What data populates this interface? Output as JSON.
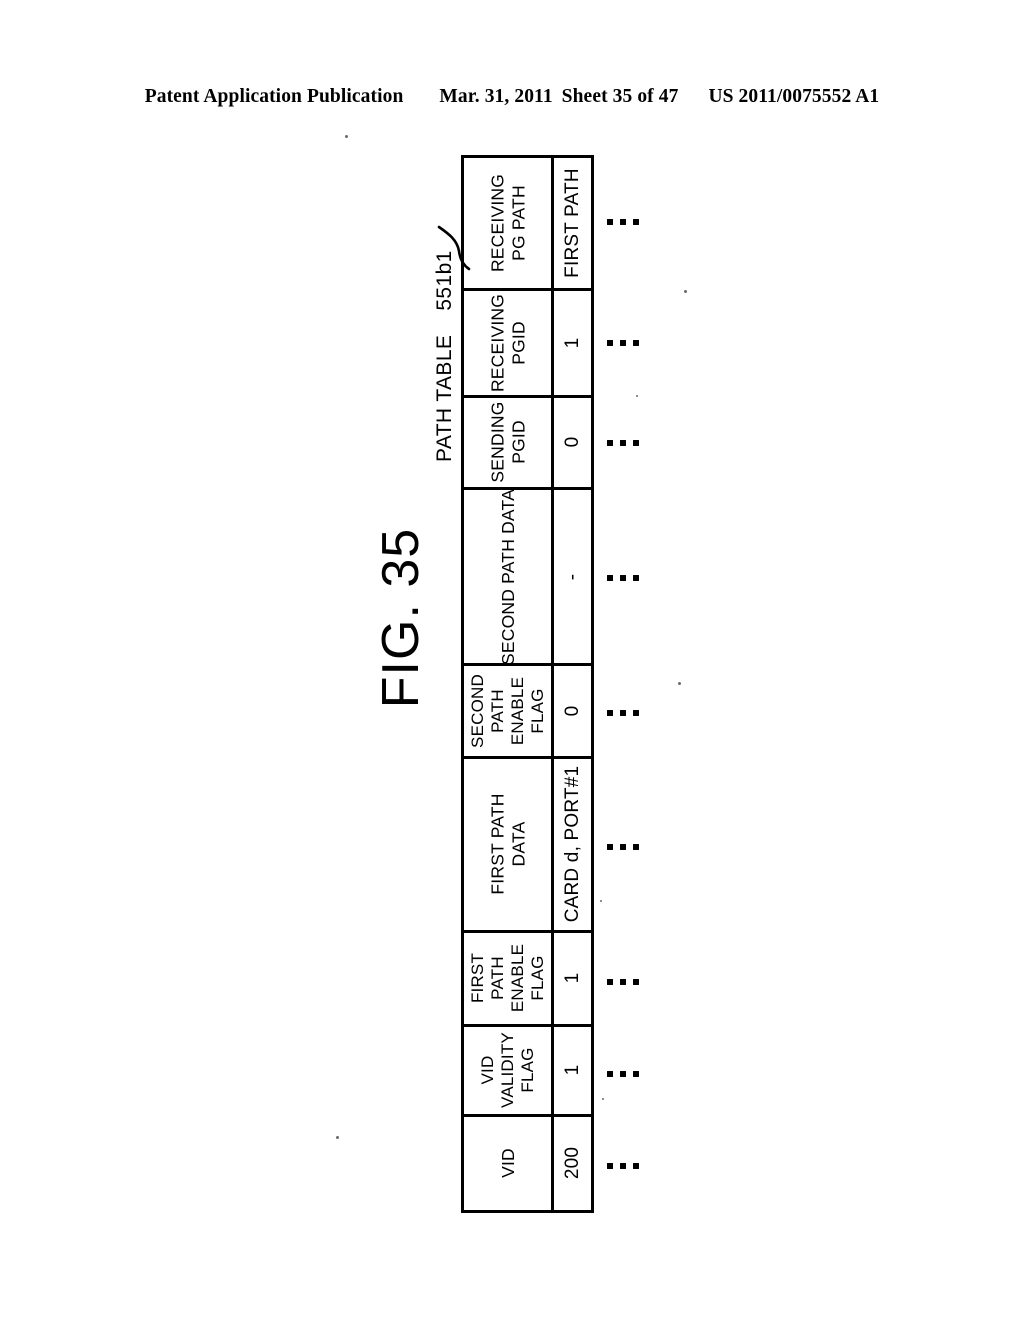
{
  "page_header": {
    "publication": "Patent Application Publication",
    "date": "Mar. 31, 2011",
    "sheet": "Sheet 35 of 47",
    "patent_number": "US 2011/0075552 A1"
  },
  "figure": {
    "label": "FIG. 35"
  },
  "table_caption": {
    "title": "PATH TABLE",
    "reference_numeral": "551b1"
  },
  "chart_data": {
    "type": "table",
    "title": "PATH TABLE",
    "reference_numeral": "551b1",
    "orientation": "rotated-90-ccw",
    "columns": [
      "VID",
      "VID VALIDITY FLAG",
      "FIRST PATH ENABLE FLAG",
      "FIRST PATH DATA",
      "SECOND PATH ENABLE FLAG",
      "SECOND PATH DATA",
      "SENDING PGID",
      "RECEIVING PGID",
      "RECEIVING PG PATH"
    ],
    "rows": [
      [
        "200",
        "1",
        "1",
        "CARD d, PORT#1",
        "0",
        "-",
        "0",
        "1",
        "FIRST PATH"
      ]
    ],
    "continuation_marker": "..."
  },
  "table": {
    "fields": [
      {
        "header_lines": [
          "RECEIVING",
          "PG PATH"
        ],
        "value": "FIRST PATH",
        "ellipsis": "..."
      },
      {
        "header_lines": [
          "RECEIVING",
          "PGID"
        ],
        "value": "1",
        "ellipsis": "..."
      },
      {
        "header_lines": [
          "SENDING",
          "PGID"
        ],
        "value": "0",
        "ellipsis": "..."
      },
      {
        "header_lines": [
          "SECOND PATH DATA"
        ],
        "value": "-",
        "ellipsis": "..."
      },
      {
        "header_lines": [
          "SECOND",
          "PATH",
          "ENABLE",
          "FLAG"
        ],
        "value": "0",
        "ellipsis": "..."
      },
      {
        "header_lines": [
          "FIRST PATH",
          "DATA"
        ],
        "value": "CARD d, PORT#1",
        "ellipsis": "..."
      },
      {
        "header_lines": [
          "FIRST",
          "PATH",
          "ENABLE",
          "FLAG"
        ],
        "value": "1",
        "ellipsis": "..."
      },
      {
        "header_lines": [
          "VID",
          "VALIDITY",
          "FLAG"
        ],
        "value": "1",
        "ellipsis": "..."
      },
      {
        "header_lines": [
          "VID"
        ],
        "value": "200",
        "ellipsis": "..."
      }
    ]
  }
}
